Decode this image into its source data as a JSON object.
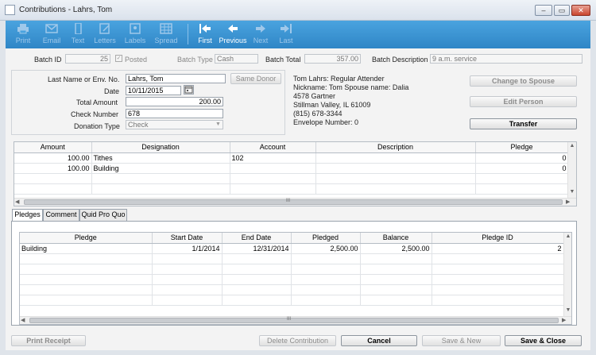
{
  "window": {
    "title": "Contributions - Lahrs, Tom",
    "min": "–",
    "max": "▭",
    "close": "✕"
  },
  "toolbar": {
    "items": [
      {
        "label": "Print",
        "icon": "printer-icon",
        "enabled": false
      },
      {
        "label": "Email",
        "icon": "envelope-icon",
        "enabled": false
      },
      {
        "label": "Text",
        "icon": "phone-icon",
        "enabled": false
      },
      {
        "label": "Letters",
        "icon": "letter-icon",
        "enabled": false
      },
      {
        "label": "Labels",
        "icon": "label-icon",
        "enabled": false
      },
      {
        "label": "Spread",
        "icon": "spreadsheet-icon",
        "enabled": false
      },
      {
        "label": "First",
        "icon": "first-record-icon",
        "enabled": true
      },
      {
        "label": "Previous",
        "icon": "previous-arrow-icon",
        "enabled": true
      },
      {
        "label": "Next",
        "icon": "next-arrow-icon",
        "enabled": false
      },
      {
        "label": "Last",
        "icon": "last-record-icon",
        "enabled": false
      }
    ]
  },
  "batch": {
    "id_label": "Batch ID",
    "id_value": "25",
    "posted_label": "Posted",
    "type_label": "Batch Type",
    "type_value": "Cash",
    "total_label": "Batch Total",
    "total_value": "357.00",
    "desc_label": "Batch Description",
    "desc_value": "9 a.m. service"
  },
  "form": {
    "name_label": "Last Name or Env. No.",
    "name_value": "Lahrs, Tom",
    "same_donor": "Same Donor",
    "date_label": "Date",
    "date_value": "10/11/2015",
    "total_label": "Total Amount",
    "total_value": "200.00",
    "check_label": "Check Number",
    "check_value": "678",
    "type_label": "Donation Type",
    "type_value": "Check"
  },
  "person": {
    "line1": "Tom Lahrs: Regular Attender",
    "line2": "Nickname: Tom   Spouse name: Dalia",
    "line3": "4578 Gartner",
    "line4": "Stillman Valley, IL 61009",
    "line5": "(815) 678-3344",
    "line6": "Envelope Number: 0"
  },
  "actions": {
    "change_spouse": "Change to Spouse",
    "edit_person": "Edit Person",
    "transfer": "Transfer"
  },
  "designations": {
    "headers": [
      "Amount",
      "Designation",
      "Account",
      "Description",
      "Pledge"
    ],
    "rows": [
      [
        "100.00",
        "Tithes",
        "102",
        "",
        "0"
      ],
      [
        "100.00",
        "Building",
        "",
        "",
        "0"
      ]
    ]
  },
  "tabs": [
    "Pledges",
    "Comment",
    "Quid Pro Quo"
  ],
  "pledges": {
    "headers": [
      "Pledge",
      "Start Date",
      "End Date",
      "Pledged",
      "Balance",
      "Pledge ID"
    ],
    "rows": [
      [
        "Building",
        "1/1/2014",
        "12/31/2014",
        "2,500.00",
        "2,500.00",
        "2"
      ]
    ]
  },
  "footer": {
    "print_receipt": "Print Receipt",
    "delete": "Delete Contribution",
    "cancel": "Cancel",
    "save_new": "Save & New",
    "save_close": "Save & Close"
  },
  "scroll": {
    "mark": "III"
  }
}
